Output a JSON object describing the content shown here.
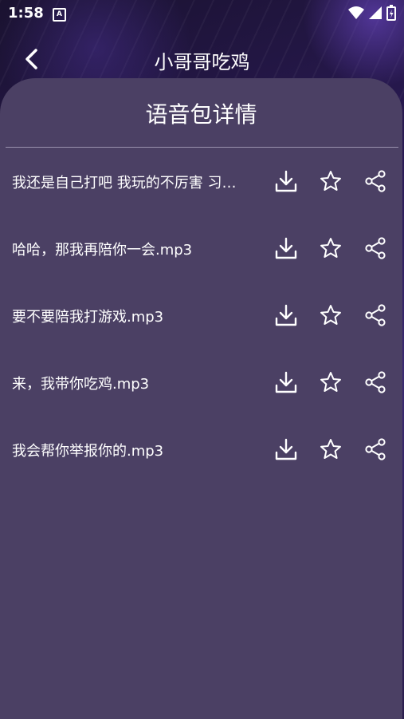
{
  "status_bar": {
    "time": "1:58",
    "notification_letter": "A"
  },
  "header": {
    "title": "小哥哥吃鸡"
  },
  "panel": {
    "title": "语音包详情"
  },
  "items": [
    {
      "label": "我还是自己打吧 我玩的不厉害 习…"
    },
    {
      "label": "哈哈，那我再陪你一会.mp3"
    },
    {
      "label": "要不要陪我打游戏.mp3"
    },
    {
      "label": "来，我带你吃鸡.mp3"
    },
    {
      "label": "我会帮你举报你的.mp3"
    }
  ],
  "icons": {
    "download": "download-icon",
    "favorite": "star-icon",
    "share": "share-icon"
  },
  "colors": {
    "panel": "#4b4064",
    "text": "#ffffff"
  }
}
